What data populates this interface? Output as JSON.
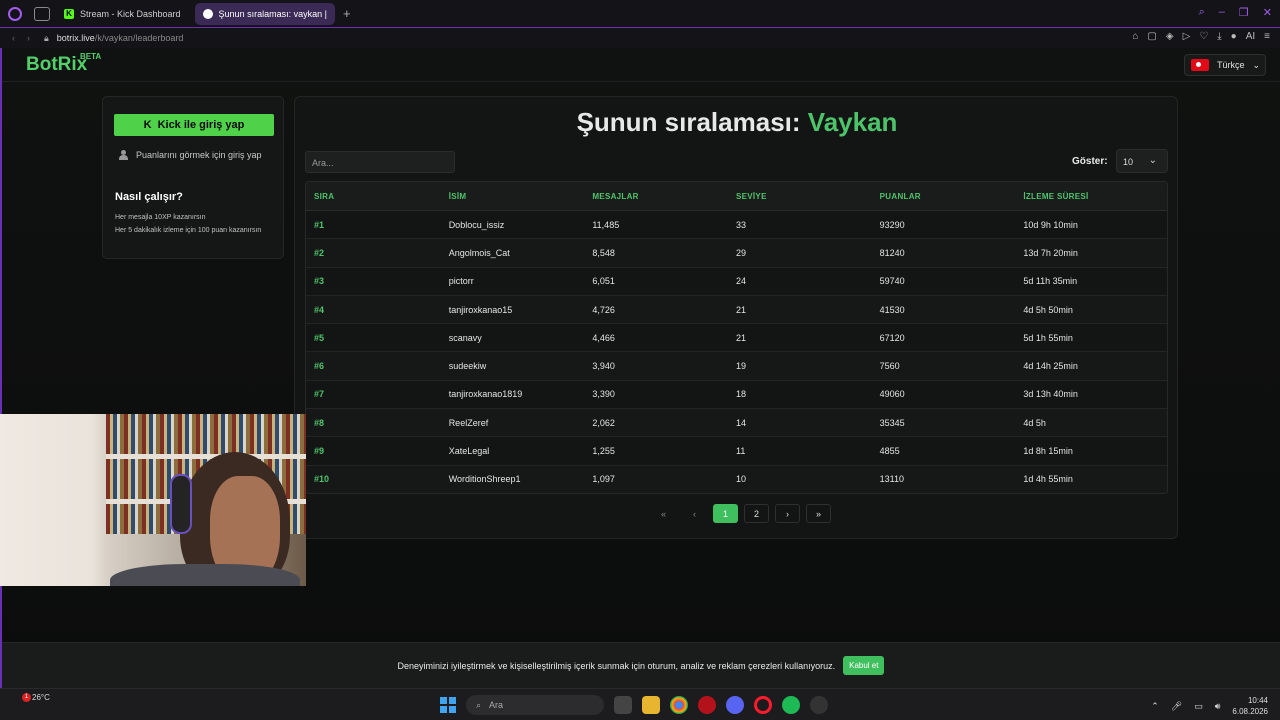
{
  "browser": {
    "tabs": [
      {
        "label": "Stream - Kick Dashboard",
        "active": false
      },
      {
        "label": "Şunun sıralaması: vaykan |",
        "active": true
      }
    ],
    "url_host": "botrix.live",
    "url_path": "/k/vaykan/leaderboard"
  },
  "site": {
    "logo": "BotRix",
    "logo_badge": "BETA",
    "language": "Türkçe"
  },
  "sidebar": {
    "login_button": "Kick ile giriş yap",
    "login_hint": "Puanlarını görmek için giriş yap",
    "how_title": "Nasıl çalışır?",
    "how_lines": [
      "Her mesajla 10XP kazanırsın",
      "Her 5 dakikalık izleme için 100 puan kazanırsın"
    ]
  },
  "leaderboard": {
    "title_prefix": "Şunun sıralaması:",
    "title_name": "Vaykan",
    "search_placeholder": "Ara...",
    "show_label": "Göster:",
    "show_value": "10",
    "columns": [
      "SIRA",
      "İSİM",
      "MESAJLAR",
      "SEVİYE",
      "PUANLAR",
      "İZLEME SÜRESİ"
    ],
    "rows": [
      [
        "#1",
        "Doblocu_issiz",
        "11,485",
        "33",
        "93290",
        "10d 9h 10min"
      ],
      [
        "#2",
        "Angolmois_Cat",
        "8,548",
        "29",
        "81240",
        "13d 7h 20min"
      ],
      [
        "#3",
        "pictorr",
        "6,051",
        "24",
        "59740",
        "5d 11h 35min"
      ],
      [
        "#4",
        "tanjiroxkanao15",
        "4,726",
        "21",
        "41530",
        "4d 5h 50min"
      ],
      [
        "#5",
        "scanavy",
        "4,466",
        "21",
        "67120",
        "5d 1h 55min"
      ],
      [
        "#6",
        "sudeekiw",
        "3,940",
        "19",
        "7560",
        "4d 14h 25min"
      ],
      [
        "#7",
        "tanjiroxkanao1819",
        "3,390",
        "18",
        "49060",
        "3d 13h 40min"
      ],
      [
        "#8",
        "ReelZeref",
        "2,062",
        "14",
        "35345",
        "4d 5h"
      ],
      [
        "#9",
        "XateLegal",
        "1,255",
        "11",
        "4855",
        "1d 8h 15min"
      ],
      [
        "#10",
        "WorditionShreep1",
        "1,097",
        "10",
        "13110",
        "1d 4h 55min"
      ]
    ],
    "pages": [
      "1",
      "2"
    ],
    "current_page": "1"
  },
  "cookie": {
    "text": "Deneyiminizi iyileştirmek ve kişiselleştirilmiş içerik sunmak için oturum, analiz ve reklam çerezleri kullanıyoruz.",
    "accept": "Kabul et"
  },
  "taskbar": {
    "temperature": "26°C",
    "search_placeholder": "Ara",
    "time": "10:44",
    "date": "6.08.2026",
    "notif_count": "1"
  },
  "colors": {
    "accent": "#4ec46a",
    "browser_accent": "#a35cf2"
  }
}
